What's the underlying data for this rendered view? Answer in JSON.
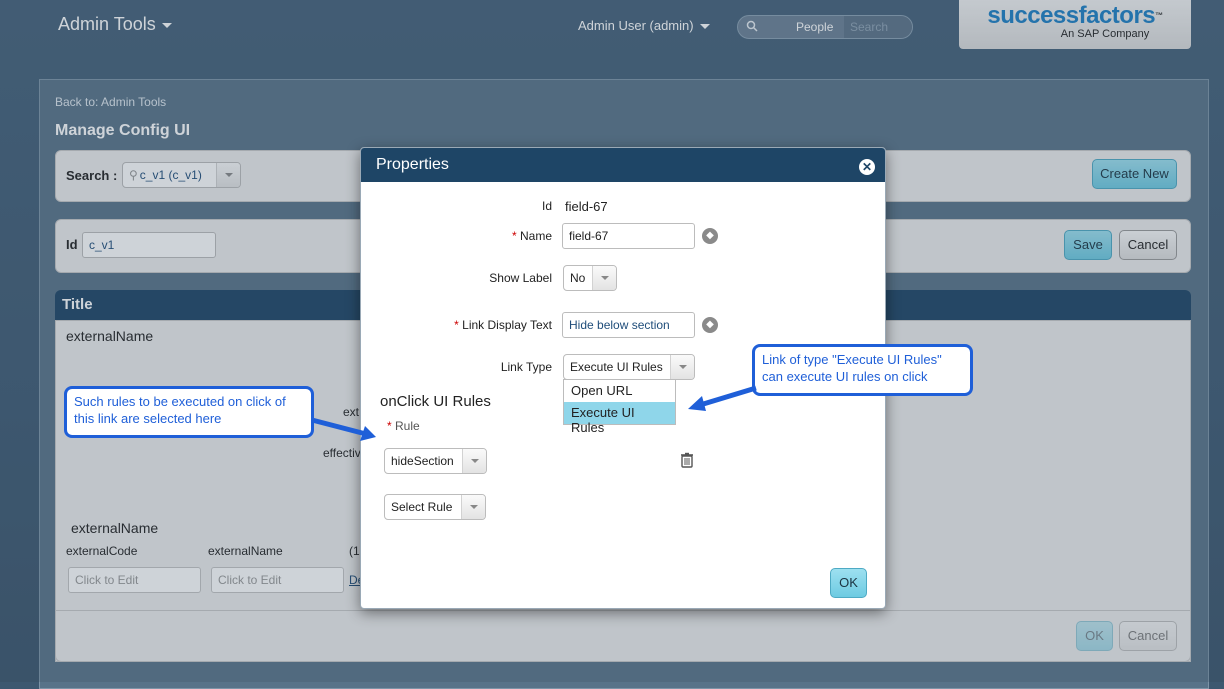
{
  "topbar": {
    "title": "Admin Tools",
    "user": "Admin User (admin)",
    "search_scope": "People",
    "search_placeholder": "Search",
    "logo_brand": "successfactors",
    "logo_sub": "An SAP Company"
  },
  "page": {
    "back_link": "Back to: Admin Tools",
    "title": "Manage Config UI",
    "search_label": "Search :",
    "search_value": "c_v1 (c_v1)",
    "create_new": "Create New",
    "id_label": "Id",
    "id_value": "c_v1",
    "save": "Save",
    "cancel": "Cancel",
    "section_title": "Title",
    "external_name_1": "externalName",
    "partial_ext": "ext",
    "partial_effective": "effectiv",
    "external_name_2": "externalName",
    "col_external_code": "externalCode",
    "col_external_name": "externalName",
    "col_partial": "(1",
    "click_to_edit_1": "Click to Edit",
    "click_to_edit_2": "Click to Edit",
    "partial_link": "De",
    "ok_bottom": "OK",
    "cancel_bottom": "Cancel"
  },
  "modal": {
    "title": "Properties",
    "id_label": "Id",
    "id_value": "field-67",
    "name_label": "Name",
    "name_value": "field-67",
    "show_label_label": "Show Label",
    "show_label_value": "No",
    "link_text_label": "Link Display Text",
    "link_text_value": "Hide below section",
    "link_type_label": "Link Type",
    "link_type_value": "Execute UI Rules",
    "link_type_options": [
      "Open URL",
      "Execute UI Rules"
    ],
    "onclick_heading": "onClick UI Rules",
    "rule_label": "Rule",
    "rule_value": "hideSection",
    "select_rule": "Select Rule",
    "ok": "OK"
  },
  "callouts": {
    "left": "Such rules to be executed on click of this link are selected here",
    "right": "Link of type \"Execute UI Rules\" can execute UI rules on click"
  },
  "colors": {
    "header_navy": "#1e4566",
    "accent_blue_button": "#6ecbe2",
    "callout_blue": "#1f5fd8",
    "selected_option": "#8fd6ea"
  }
}
